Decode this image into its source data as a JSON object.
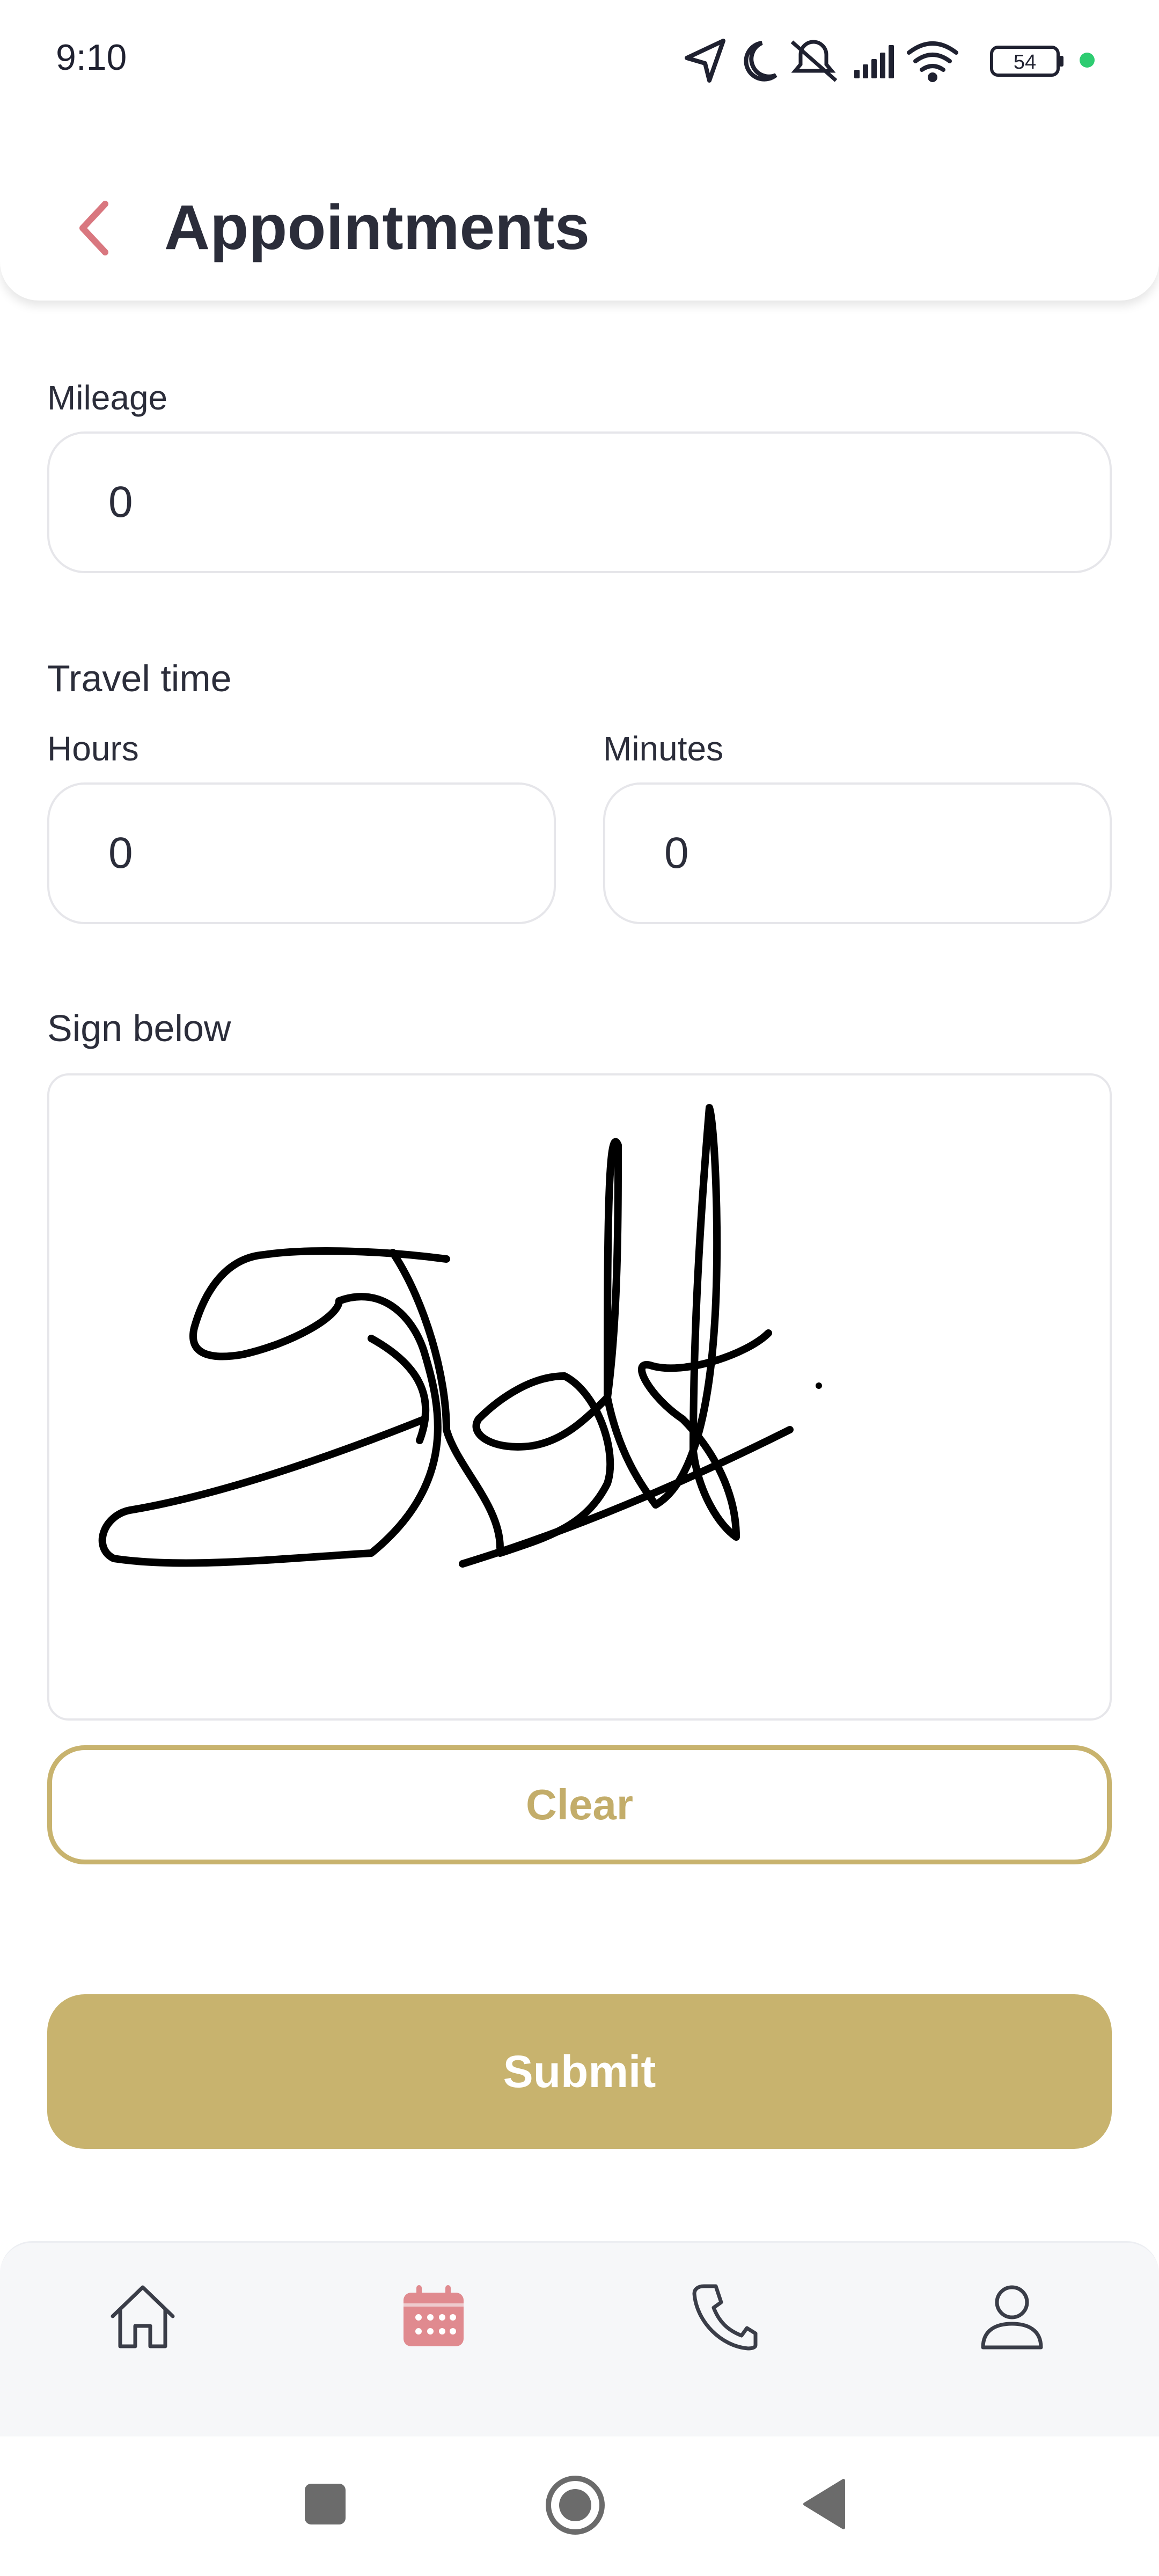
{
  "status_bar": {
    "time": "9:10",
    "battery": "54",
    "icons": [
      "location-icon",
      "moon-icon",
      "bell-off-icon",
      "signal-icon",
      "wifi-icon",
      "battery-icon"
    ],
    "dot_color": "#2ecc71"
  },
  "header": {
    "title": "Appointments",
    "back_icon": "chevron-left-icon",
    "accent": "#d9777f"
  },
  "form": {
    "mileage_label": "Mileage",
    "mileage_value": "0",
    "travel_time_label": "Travel time",
    "hours_label": "Hours",
    "hours_value": "0",
    "minutes_label": "Minutes",
    "minutes_value": "0",
    "signature_label": "Sign below"
  },
  "buttons": {
    "clear": "Clear",
    "submit": "Submit",
    "accent": "#c8b36e"
  },
  "bottom_nav": {
    "items": [
      {
        "name": "home",
        "icon": "home-icon",
        "active": false
      },
      {
        "name": "appointments",
        "icon": "calendar-icon",
        "active": true
      },
      {
        "name": "calls",
        "icon": "phone-icon",
        "active": false
      },
      {
        "name": "profile",
        "icon": "user-icon",
        "active": false
      }
    ],
    "active_color": "#e08a8f"
  },
  "system_nav": {
    "icons": [
      "recents-square-icon",
      "home-circle-icon",
      "back-triangle-icon"
    ]
  }
}
